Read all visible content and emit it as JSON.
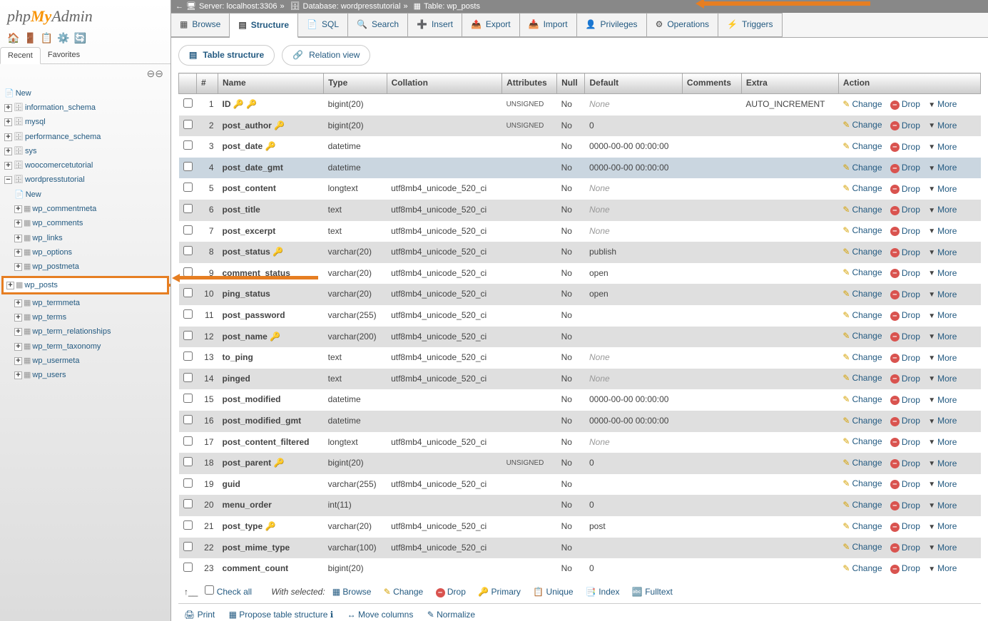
{
  "logo": {
    "p1": "php",
    "p2": "My",
    "p3": "Admin"
  },
  "sidebarTabs": {
    "recent": "Recent",
    "favorites": "Favorites"
  },
  "tree": {
    "new": "New",
    "dbs": [
      "information_schema",
      "mysql",
      "performance_schema",
      "sys",
      "woocomercetutorial",
      "wordpresstutorial"
    ],
    "wpNew": "New",
    "wpTables": [
      "wp_commentmeta",
      "wp_comments",
      "wp_links",
      "wp_options",
      "wp_postmeta",
      "wp_posts",
      "wp_termmeta",
      "wp_terms",
      "wp_term_relationships",
      "wp_term_taxonomy",
      "wp_usermeta",
      "wp_users"
    ]
  },
  "breadcrumb": {
    "srvLabel": "Server:",
    "srv": "localhost:3306",
    "dbLabel": "Database:",
    "db": "wordpresstutorial",
    "tblLabel": "Table:",
    "tbl": "wp_posts",
    "sep": "»"
  },
  "tabs": [
    {
      "name": "browse",
      "label": "Browse"
    },
    {
      "name": "structure",
      "label": "Structure",
      "active": true
    },
    {
      "name": "sql",
      "label": "SQL"
    },
    {
      "name": "search",
      "label": "Search"
    },
    {
      "name": "insert",
      "label": "Insert"
    },
    {
      "name": "export",
      "label": "Export"
    },
    {
      "name": "import",
      "label": "Import"
    },
    {
      "name": "privileges",
      "label": "Privileges"
    },
    {
      "name": "operations",
      "label": "Operations"
    },
    {
      "name": "triggers",
      "label": "Triggers"
    }
  ],
  "subtabs": {
    "structure": "Table structure",
    "relation": "Relation view"
  },
  "headers": {
    "num": "#",
    "name": "Name",
    "type": "Type",
    "collation": "Collation",
    "attributes": "Attributes",
    "null": "Null",
    "default": "Default",
    "comments": "Comments",
    "extra": "Extra",
    "action": "Action"
  },
  "actionsLabels": {
    "change": "Change",
    "drop": "Drop",
    "more": "More"
  },
  "columns": [
    {
      "n": "1",
      "name": "ID",
      "key": true,
      "idx": true,
      "type": "bigint(20)",
      "coll": "",
      "attr": "UNSIGNED",
      "null": "No",
      "def": "None",
      "defNone": true,
      "extra": "AUTO_INCREMENT"
    },
    {
      "n": "2",
      "name": "post_author",
      "idx": true,
      "type": "bigint(20)",
      "coll": "",
      "attr": "UNSIGNED",
      "null": "No",
      "def": "0"
    },
    {
      "n": "3",
      "name": "post_date",
      "idx": true,
      "type": "datetime",
      "coll": "",
      "attr": "",
      "null": "No",
      "def": "0000-00-00 00:00:00"
    },
    {
      "n": "4",
      "name": "post_date_gmt",
      "type": "datetime",
      "coll": "",
      "attr": "",
      "null": "No",
      "def": "0000-00-00 00:00:00",
      "sel": true
    },
    {
      "n": "5",
      "name": "post_content",
      "type": "longtext",
      "coll": "utf8mb4_unicode_520_ci",
      "attr": "",
      "null": "No",
      "def": "None",
      "defNone": true
    },
    {
      "n": "6",
      "name": "post_title",
      "type": "text",
      "coll": "utf8mb4_unicode_520_ci",
      "attr": "",
      "null": "No",
      "def": "None",
      "defNone": true
    },
    {
      "n": "7",
      "name": "post_excerpt",
      "type": "text",
      "coll": "utf8mb4_unicode_520_ci",
      "attr": "",
      "null": "No",
      "def": "None",
      "defNone": true
    },
    {
      "n": "8",
      "name": "post_status",
      "idx": true,
      "type": "varchar(20)",
      "coll": "utf8mb4_unicode_520_ci",
      "attr": "",
      "null": "No",
      "def": "publish"
    },
    {
      "n": "9",
      "name": "comment_status",
      "type": "varchar(20)",
      "coll": "utf8mb4_unicode_520_ci",
      "attr": "",
      "null": "No",
      "def": "open",
      "arrow": true
    },
    {
      "n": "10",
      "name": "ping_status",
      "type": "varchar(20)",
      "coll": "utf8mb4_unicode_520_ci",
      "attr": "",
      "null": "No",
      "def": "open"
    },
    {
      "n": "11",
      "name": "post_password",
      "type": "varchar(255)",
      "coll": "utf8mb4_unicode_520_ci",
      "attr": "",
      "null": "No",
      "def": ""
    },
    {
      "n": "12",
      "name": "post_name",
      "idx": true,
      "type": "varchar(200)",
      "coll": "utf8mb4_unicode_520_ci",
      "attr": "",
      "null": "No",
      "def": ""
    },
    {
      "n": "13",
      "name": "to_ping",
      "type": "text",
      "coll": "utf8mb4_unicode_520_ci",
      "attr": "",
      "null": "No",
      "def": "None",
      "defNone": true
    },
    {
      "n": "14",
      "name": "pinged",
      "type": "text",
      "coll": "utf8mb4_unicode_520_ci",
      "attr": "",
      "null": "No",
      "def": "None",
      "defNone": true
    },
    {
      "n": "15",
      "name": "post_modified",
      "type": "datetime",
      "coll": "",
      "attr": "",
      "null": "No",
      "def": "0000-00-00 00:00:00"
    },
    {
      "n": "16",
      "name": "post_modified_gmt",
      "type": "datetime",
      "coll": "",
      "attr": "",
      "null": "No",
      "def": "0000-00-00 00:00:00"
    },
    {
      "n": "17",
      "name": "post_content_filtered",
      "type": "longtext",
      "coll": "utf8mb4_unicode_520_ci",
      "attr": "",
      "null": "No",
      "def": "None",
      "defNone": true
    },
    {
      "n": "18",
      "name": "post_parent",
      "idx": true,
      "type": "bigint(20)",
      "coll": "",
      "attr": "UNSIGNED",
      "null": "No",
      "def": "0"
    },
    {
      "n": "19",
      "name": "guid",
      "type": "varchar(255)",
      "coll": "utf8mb4_unicode_520_ci",
      "attr": "",
      "null": "No",
      "def": ""
    },
    {
      "n": "20",
      "name": "menu_order",
      "type": "int(11)",
      "coll": "",
      "attr": "",
      "null": "No",
      "def": "0"
    },
    {
      "n": "21",
      "name": "post_type",
      "idx": true,
      "type": "varchar(20)",
      "coll": "utf8mb4_unicode_520_ci",
      "attr": "",
      "null": "No",
      "def": "post"
    },
    {
      "n": "22",
      "name": "post_mime_type",
      "type": "varchar(100)",
      "coll": "utf8mb4_unicode_520_ci",
      "attr": "",
      "null": "No",
      "def": ""
    },
    {
      "n": "23",
      "name": "comment_count",
      "type": "bigint(20)",
      "coll": "",
      "attr": "",
      "null": "No",
      "def": "0"
    }
  ],
  "footer1": {
    "checkAll": "Check all",
    "withSelected": "With selected:",
    "browse": "Browse",
    "change": "Change",
    "drop": "Drop",
    "primary": "Primary",
    "unique": "Unique",
    "index": "Index",
    "fulltext": "Fulltext"
  },
  "footer2": {
    "print": "Print",
    "propose": "Propose table structure",
    "move": "Move columns",
    "normalize": "Normalize"
  }
}
